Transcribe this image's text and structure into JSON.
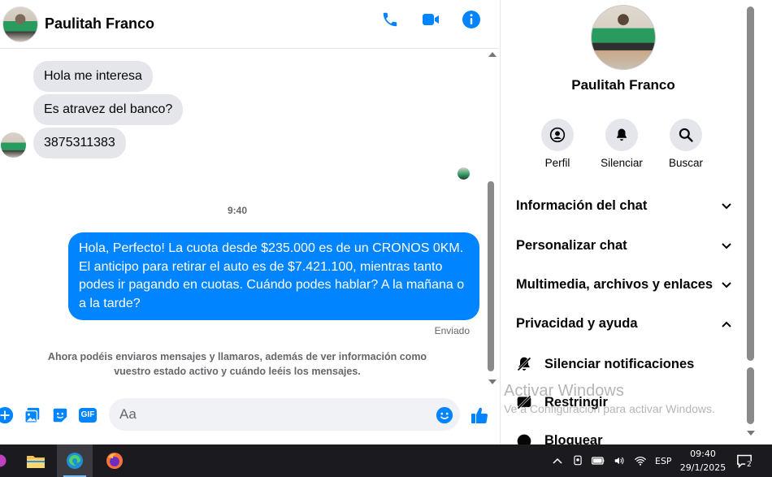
{
  "chat": {
    "contact_name": "Paulitah Franco",
    "messages_in": [
      "Hola me interesa",
      "Es atravez del banco?",
      "3875311383"
    ],
    "timestamp": "9:40",
    "message_out": "Hola, Perfecto! La cuota desde $235.000 es de un CRONOS 0KM. El anticipo para retirar el auto es de $7.421.100, mientras tanto podes ir pagando en cuotas. Cuándo podes hablar? A la mañana o a la tarde?",
    "status": "Enviado",
    "system_note": "Ahora podéis enviaros mensajes y llamaros, además de ver información como vuestro estado activo y cuándo leéis los mensajes.",
    "composer_placeholder": "Aa",
    "gif_label": "GIF"
  },
  "info": {
    "name": "Paulitah Franco",
    "actions": [
      {
        "label": "Perfil",
        "icon": "profile-icon"
      },
      {
        "label": "Silenciar",
        "icon": "bell-icon"
      },
      {
        "label": "Buscar",
        "icon": "search-icon"
      }
    ],
    "sections": [
      {
        "label": "Información del chat",
        "expanded": false
      },
      {
        "label": "Personalizar chat",
        "expanded": false
      },
      {
        "label": "Multimedia, archivos y enlaces",
        "expanded": false
      },
      {
        "label": "Privacidad y ayuda",
        "expanded": true
      }
    ],
    "privacy_items": [
      {
        "label": "Silenciar notificaciones",
        "icon": "bell-off-icon"
      },
      {
        "label": "Restringir",
        "icon": "restrict-icon"
      },
      {
        "label": "Bloquear",
        "icon": "block-icon"
      }
    ]
  },
  "watermark": {
    "line1": "Activar Windows",
    "line2": "Ve a Configuración para activar Windows."
  },
  "taskbar": {
    "lang": "ESP",
    "time": "09:40",
    "date": "29/1/2025",
    "notification_count": "2"
  },
  "colors": {
    "accent": "#0084ff",
    "incoming_bubble": "#e4e6eb",
    "taskbar": "#1b1b1f"
  }
}
